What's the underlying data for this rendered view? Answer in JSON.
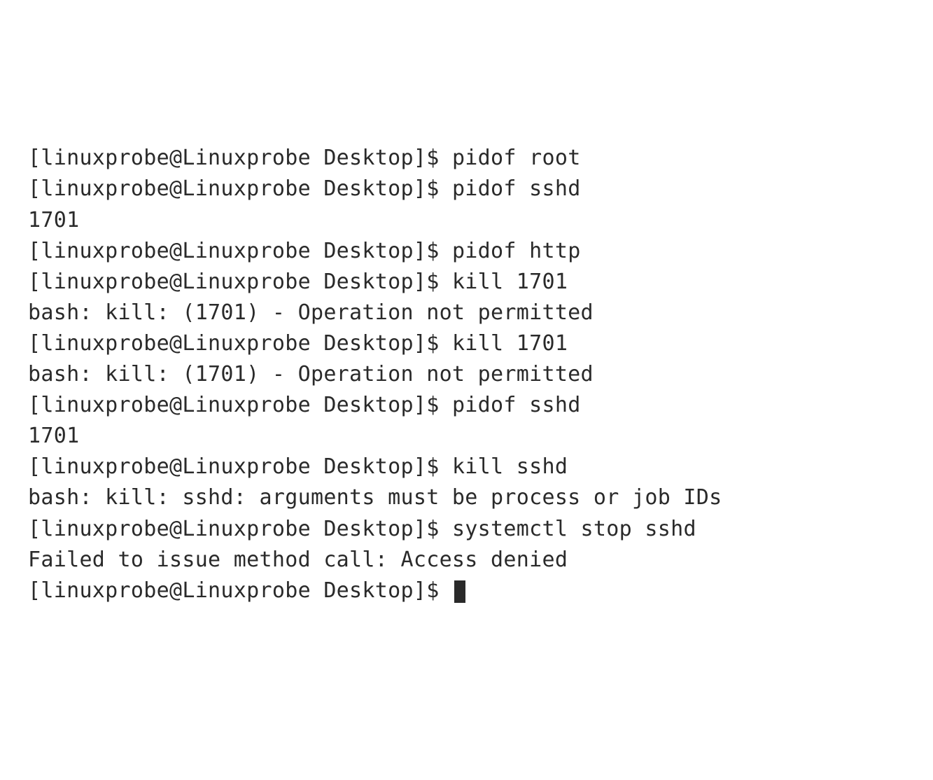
{
  "prompt": "[linuxprobe@Linuxprobe Desktop]$ ",
  "lines": [
    {
      "type": "cmd",
      "command": "pidof root"
    },
    {
      "type": "cmd",
      "command": "pidof sshd"
    },
    {
      "type": "out",
      "text": "1701"
    },
    {
      "type": "cmd",
      "command": "pidof http"
    },
    {
      "type": "cmd",
      "command": "kill 1701"
    },
    {
      "type": "out",
      "text": "bash: kill: (1701) - Operation not permitted"
    },
    {
      "type": "cmd",
      "command": "kill 1701"
    },
    {
      "type": "out",
      "text": "bash: kill: (1701) - Operation not permitted"
    },
    {
      "type": "cmd",
      "command": "pidof sshd"
    },
    {
      "type": "out",
      "text": "1701"
    },
    {
      "type": "cmd",
      "command": "kill sshd"
    },
    {
      "type": "out",
      "text": "bash: kill: sshd: arguments must be process or job IDs"
    },
    {
      "type": "cmd",
      "command": "systemctl stop sshd"
    },
    {
      "type": "out",
      "text": "Failed to issue method call: Access denied"
    },
    {
      "type": "cursor"
    }
  ]
}
